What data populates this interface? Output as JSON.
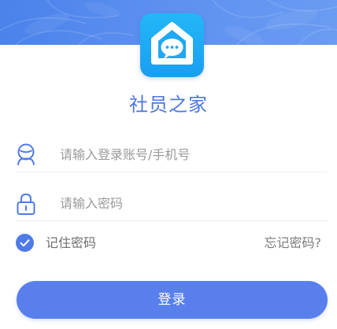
{
  "app": {
    "title": "社员之家",
    "logo_icon": "chat-bubble-house-icon"
  },
  "login_form": {
    "username": {
      "icon": "user-icon",
      "placeholder": "请输入登录账号/手机号",
      "value": ""
    },
    "password": {
      "icon": "lock-icon",
      "placeholder": "请输入密码",
      "value": ""
    },
    "remember_password": {
      "label": "记住密码",
      "checked": true,
      "icon": "check-icon"
    },
    "forgot_password_label": "忘记密码?",
    "submit_label": "登录"
  },
  "colors": {
    "primary": "#587fec",
    "title_blue": "#4b77e0",
    "logo_blue": "#1a9ef2",
    "header_blue": "#4a82ea",
    "placeholder_gray": "#9a9a9a"
  }
}
